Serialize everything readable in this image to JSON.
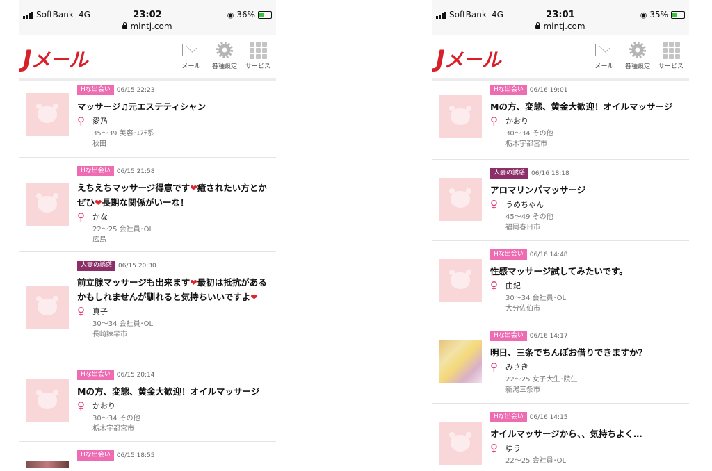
{
  "colors": {
    "brand_red": "#d8202a",
    "badge_pink": "#ee6cb2",
    "badge_purple": "#8c2f68",
    "thumb_placeholder": "#f9d7d9",
    "female_symbol": "#e23a7a"
  },
  "left": {
    "status": {
      "carrier": "SoftBank",
      "network": "4G",
      "time": "23:02",
      "battery": "36%",
      "url": "mintj.com"
    },
    "header": {
      "logo": "Jメール",
      "mail_label": "メール",
      "settings_label": "各種設定",
      "service_label": "サービス"
    },
    "posts": [
      {
        "category": "Hな出会い",
        "datetime": "06/15 22:23",
        "title": "マッサージ♫元エステティシャン",
        "name": "愛乃",
        "age_job": "35〜39 美容･ｴｽﾃ系",
        "location": "秋田"
      },
      {
        "category": "Hな出会い",
        "datetime": "06/15 21:58",
        "title": "えちえちマッサージ得意です❤️癒されたい方とかぜひ❤️長期な関係がいーな！",
        "name": "かな",
        "age_job": "22〜25 会社員･OL",
        "location": "広島"
      },
      {
        "category": "人妻の誘惑",
        "datetime": "06/15 20:30",
        "title": "前立腺マッサージも出来ます❤️最初は抵抗があるかもしれませんが馴れると気持ちいいですよ❤️",
        "name": "真子",
        "age_job": "30〜34 会社員･OL",
        "location": "長崎諫早市"
      },
      {
        "category": "Hな出会い",
        "datetime": "06/15 20:14",
        "title": "Mの方、変態、黄金大歓迎！オイルマッサージ",
        "name": "かおり",
        "age_job": "30〜34 その他",
        "location": "栃木宇都宮市"
      },
      {
        "category": "Hな出会い",
        "datetime": "06/15 18:55",
        "title": "",
        "name": "",
        "age_job": "",
        "location": ""
      }
    ]
  },
  "right": {
    "status": {
      "carrier": "SoftBank",
      "network": "4G",
      "time": "23:01",
      "battery": "35%",
      "url": "mintj.com"
    },
    "header": {
      "logo": "Jメール",
      "mail_label": "メール",
      "settings_label": "各種設定",
      "service_label": "サービス"
    },
    "posts": [
      {
        "category": "Hな出会い",
        "datetime": "06/16 19:01",
        "title": "Mの方、変態、黄金大歓迎！オイルマッサージ",
        "name": "かおり",
        "age_job": "30〜34 その他",
        "location": "栃木宇都宮市"
      },
      {
        "category": "人妻の誘惑",
        "datetime": "06/16 18:18",
        "title": "アロマリンパマッサージ",
        "name": "うめちゃん",
        "age_job": "45〜49 その他",
        "location": "福岡春日市"
      },
      {
        "category": "Hな出会い",
        "datetime": "06/16 14:48",
        "title": "性感マッサージ試してみたいです。",
        "name": "由紀",
        "age_job": "30〜34 会社員･OL",
        "location": "大分佐伯市"
      },
      {
        "category": "Hな出会い",
        "datetime": "06/16 14:17",
        "title": "明日、三条でちんぽお借りできますか？",
        "name": "みさき",
        "age_job": "22〜25 女子大生･院生",
        "location": "新潟三条市"
      },
      {
        "category": "Hな出会い",
        "datetime": "06/16 14:15",
        "title": "オイルマッサージから、、気持ちよく…",
        "name": "ゆう",
        "age_job": "22〜25 会社員･OL",
        "location": ""
      }
    ]
  }
}
